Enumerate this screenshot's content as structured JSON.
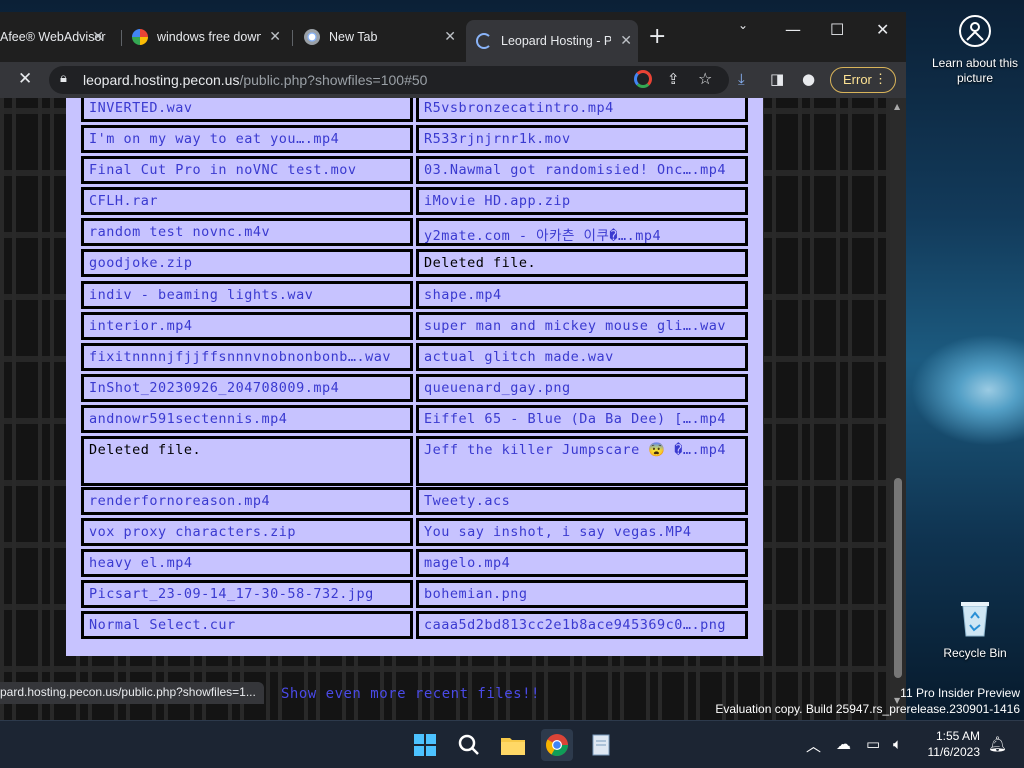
{
  "browser": {
    "tabs": [
      {
        "title": "Afee® WebAdvisor",
        "active": false
      },
      {
        "title": "windows free download",
        "active": false
      },
      {
        "title": "New Tab",
        "active": false
      },
      {
        "title": "Leopard Hosting - Pecon",
        "active": true
      }
    ],
    "url_host": "leopard.hosting.pecon.us",
    "url_path": "/public.php?showfiles=100#50",
    "error_label": "Error",
    "status_url": "pard.hosting.pecon.us/public.php?showfiles=1..."
  },
  "files": {
    "rows": [
      [
        "INVERTED.wav",
        "R5vsbronzecatintro.mp4"
      ],
      [
        "I'm on my way to eat you….mp4",
        "R533rjnjrnr1k.mov"
      ],
      [
        "Final Cut Pro in noVNC test.mov",
        "03.Nawmal got randomisied! Onc….mp4"
      ],
      [
        "CFLH.rar",
        "iMovie HD.app.zip"
      ],
      [
        "random test novnc.m4v",
        "y2mate.com - 아카츤 이쿠�….mp4"
      ],
      [
        "goodjoke.zip",
        "Deleted file."
      ],
      [
        "indiv - beaming lights.wav",
        "shape.mp4"
      ],
      [
        "interior.mp4",
        "super man and mickey mouse gli….wav"
      ],
      [
        "fixitnnnnjfjjffsnnnvnobnonbonb….wav",
        "actual glitch made.wav"
      ],
      [
        "InShot_20230926_204708009.mp4",
        "queuenard_gay.png"
      ],
      [
        "andnowr591sectennis.mp4",
        "Eiffel 65 - Blue (Da Ba Dee) [….mp4"
      ],
      [
        "Deleted file.",
        "Jeff the killer Jumpscare 😨 �….mp4"
      ],
      [
        "renderfornoreason.mp4",
        "Tweety.acs"
      ],
      [
        "vox proxy characters.zip",
        "You say inshot, i say vegas.MP4"
      ],
      [
        "heavy el.mp4",
        "magelo.mp4"
      ],
      [
        "Picsart_23-09-14_17-30-58-732.jpg",
        "bohemian.png"
      ],
      [
        "Normal Select.cur",
        "caaa5d2bd813cc2e1b8ace945369c0….png"
      ]
    ],
    "more_label": "Show even more recent files!!"
  },
  "desktop": {
    "learn_label": "Learn about this picture",
    "recycle_label": "Recycle Bin",
    "watermark_line1": "11 Pro Insider Preview",
    "watermark_line2": "Evaluation copy. Build 25947.rs_prerelease.230901-1416"
  },
  "taskbar": {
    "time": "1:55 AM",
    "date": "11/6/2023"
  }
}
